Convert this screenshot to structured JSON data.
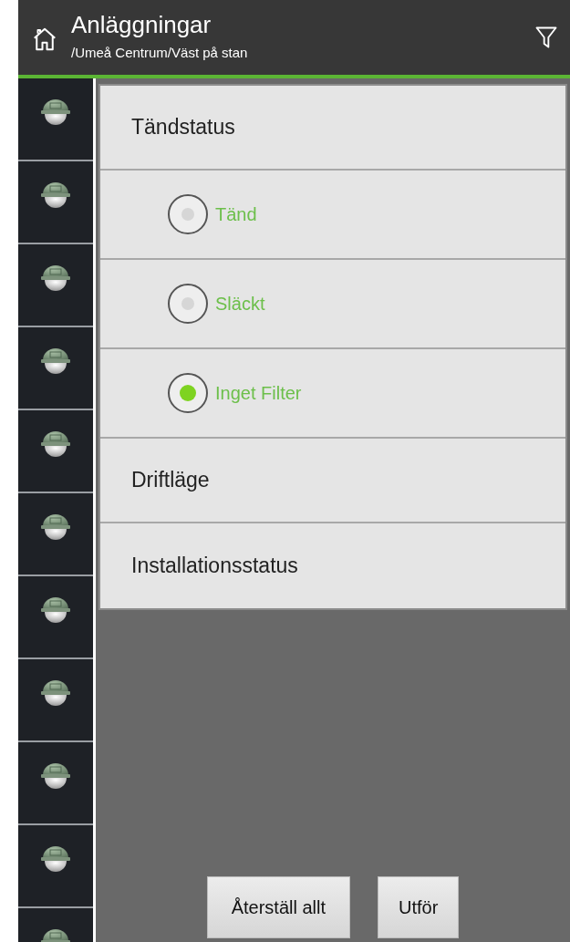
{
  "header": {
    "title": "Anläggningar",
    "path": "/Umeå Centrum/Väst på stan"
  },
  "filter_items": [
    {
      "kind": "heading",
      "label": "Tändstatus"
    },
    {
      "kind": "option",
      "label": "Tänd",
      "selected": false
    },
    {
      "kind": "option",
      "label": "Släckt",
      "selected": false
    },
    {
      "kind": "option",
      "label": "Inget Filter",
      "selected": true
    },
    {
      "kind": "heading",
      "label": "Driftläge"
    },
    {
      "kind": "heading",
      "label": "Installationsstatus"
    }
  ],
  "buttons": [
    "Återställ allt",
    "Utför"
  ]
}
